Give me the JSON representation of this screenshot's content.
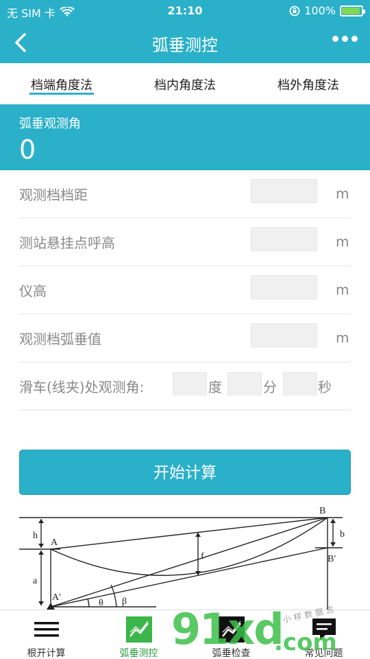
{
  "status": {
    "carrier": "无 SIM 卡",
    "time": "21:10",
    "battery_percent": "100%",
    "battery_level": 1.0
  },
  "nav": {
    "title": "弧垂测控"
  },
  "tabs": [
    {
      "label": "档端角度法",
      "active": true
    },
    {
      "label": "档内角度法",
      "active": false
    },
    {
      "label": "档外角度法",
      "active": false
    }
  ],
  "result": {
    "label": "弧垂观测角",
    "value": "0"
  },
  "form": {
    "rows": [
      {
        "label": "观测档档距",
        "value": "",
        "unit": "m"
      },
      {
        "label": "测站悬挂点呼高",
        "value": "",
        "unit": "m"
      },
      {
        "label": "仪高",
        "value": "",
        "unit": "m"
      },
      {
        "label": "观测档弧垂值",
        "value": "",
        "unit": "m"
      }
    ],
    "angle": {
      "label": "滑车(线夹)处观测角:",
      "deg_unit": "度",
      "min_unit": "分",
      "sec_unit": "秒",
      "deg_value": "",
      "min_value": "",
      "sec_value": ""
    }
  },
  "button": {
    "calc_label": "开始计算"
  },
  "diagram": {
    "labels": {
      "B_top": "B",
      "h": "h",
      "A": "A",
      "f": "f",
      "b": "b",
      "B_prime": "B′",
      "a": "a",
      "A_prime": "A′",
      "theta": "θ",
      "beta": "β"
    }
  },
  "bottom_tabs": [
    {
      "label": "根开计算",
      "icon": "menu-icon",
      "active": false
    },
    {
      "label": "弧垂测控",
      "icon": "chart-line-icon",
      "active": true
    },
    {
      "label": "弧垂检查",
      "icon": "chart-check-icon",
      "active": false
    },
    {
      "label": "常见问题",
      "icon": "chat-bubble-icon",
      "active": false
    }
  ],
  "watermark": {
    "text_main": "91xd",
    "text_domain": ".com",
    "text_small": "小样数据志"
  },
  "colors": {
    "primary": "#2bb0c9",
    "active_tab_green": "#2a9a3d",
    "watermark_green": "#3cc04a"
  }
}
